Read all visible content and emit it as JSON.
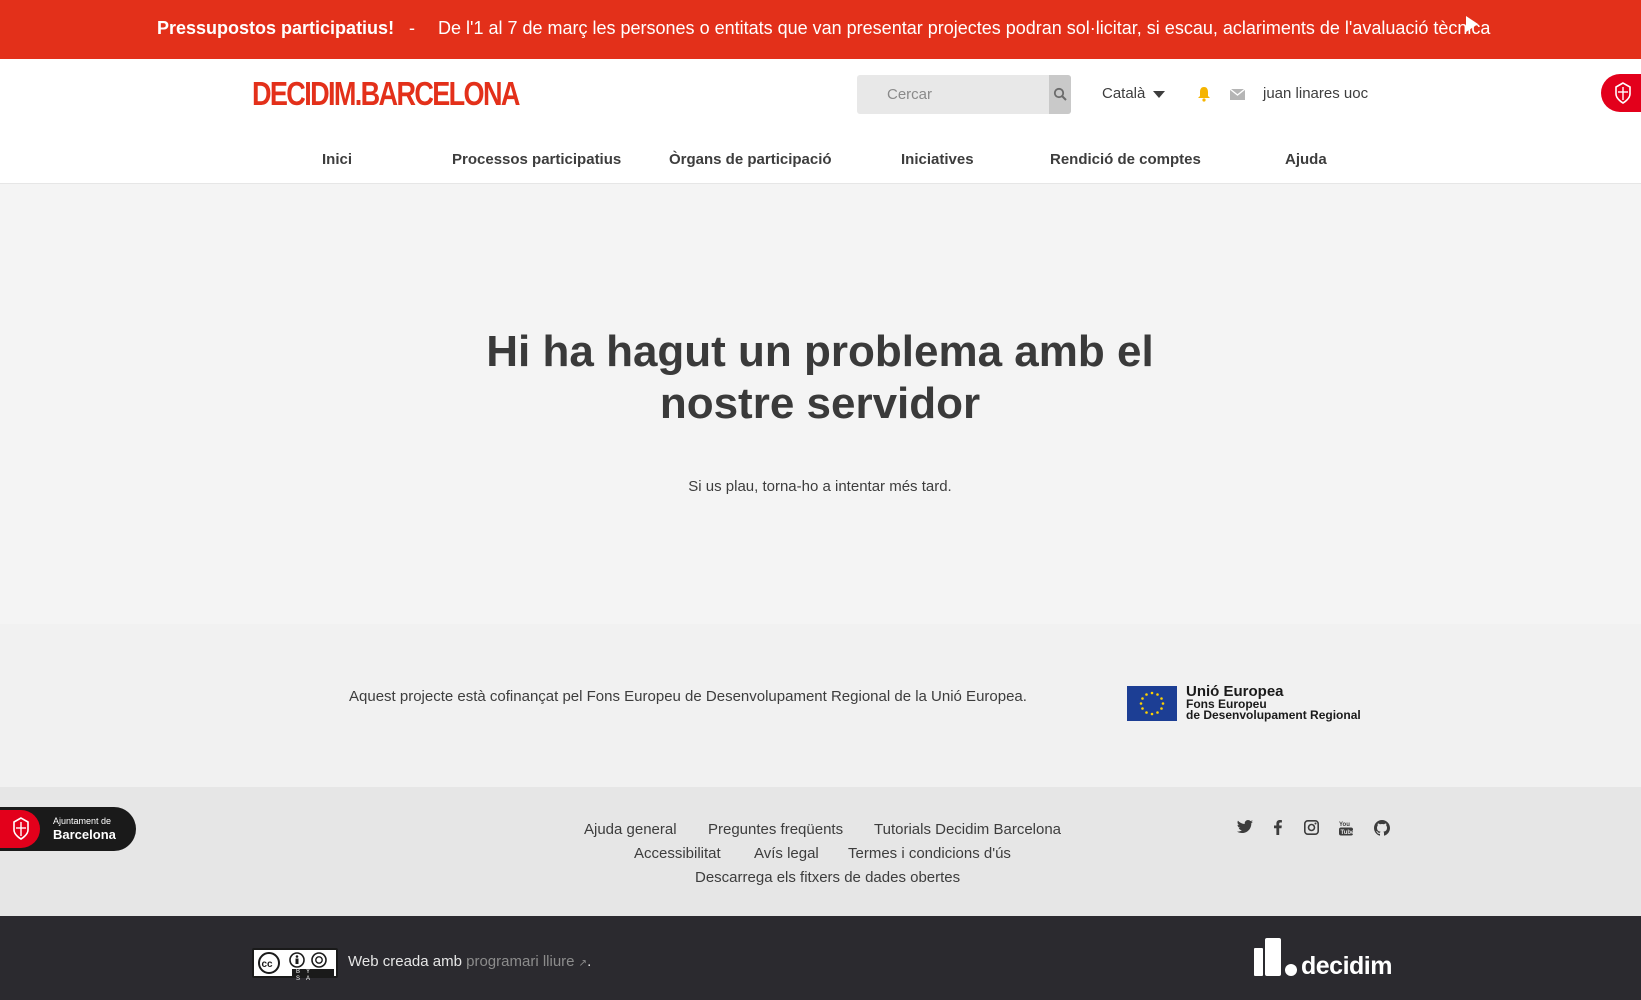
{
  "announcement": {
    "title": "Pressupostos participatius!",
    "separator": "-",
    "message": "De l'1 al 7 de març les persones o entitats que van presentar projectes podran sol·licitar, si escau, aclariments de l'avaluació tècnica"
  },
  "header": {
    "logo_text": "DECIDIM.BARCELONA",
    "search_placeholder": "Cercar",
    "language": "Català",
    "user_name": "juan linares uoc"
  },
  "nav": {
    "items": [
      {
        "label": "Inici"
      },
      {
        "label": "Processos participatius"
      },
      {
        "label": "Òrgans de participació"
      },
      {
        "label": "Iniciatives"
      },
      {
        "label": "Rendició de comptes"
      },
      {
        "label": "Ajuda"
      }
    ]
  },
  "main": {
    "title": "Hi ha hagut un problema amb el nostre servidor",
    "message": "Si us plau, torna-ho a intentar més tard."
  },
  "funding": {
    "text": "Aquest projecte està cofinançat pel Fons Europeu de Desenvolupament Regional de la Unió Europea.",
    "eu_line1": "Unió Europea",
    "eu_line2": "Fons Europeu",
    "eu_line3": "de Desenvolupament Regional"
  },
  "footer": {
    "ajuntament_line1": "Ajuntament de",
    "ajuntament_line2": "Barcelona",
    "links": [
      {
        "label": "Ajuda general"
      },
      {
        "label": "Preguntes freqüents"
      },
      {
        "label": "Tutorials Decidim Barcelona"
      },
      {
        "label": "Accessibilitat"
      },
      {
        "label": "Avís legal"
      },
      {
        "label": "Termes i condicions d'ús"
      },
      {
        "label": "Descarrega els fitxers de dades obertes"
      }
    ],
    "social_icons": [
      "twitter-icon",
      "facebook-icon",
      "instagram-icon",
      "youtube-icon",
      "github-icon"
    ]
  },
  "bottom": {
    "cc_label": "BY SA",
    "made_with": "Web creada amb",
    "free_software_link": "programari lliure",
    "period": ".",
    "decidim_word": "decidim"
  },
  "colors": {
    "brand_red": "#e3301a",
    "dark_footer": "#2b2a2f",
    "eu_blue": "#1c3e94"
  }
}
